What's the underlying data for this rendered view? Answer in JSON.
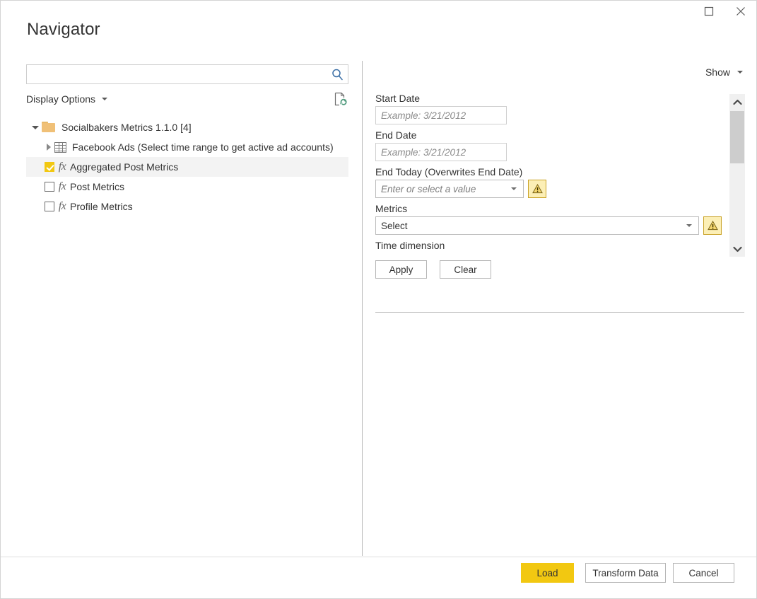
{
  "window": {
    "title": "Navigator",
    "controls": [
      {
        "name": "maximize-button",
        "icon": "maximize-icon",
        "label": ""
      },
      {
        "name": "close-button",
        "icon": "close-icon",
        "label": ""
      }
    ]
  },
  "colors": {
    "accent_yellow": "#f2c811",
    "warning_fill": "#fcefb6",
    "warning_border": "#c9a227",
    "folder_gold": "#f0c077",
    "search_icon_blue": "#3a6ea5",
    "selected_row_bg": "#f3f3f3",
    "border_gray": "#cfcfcf",
    "text_dark": "#333333"
  },
  "left_pane": {
    "search": {
      "value": "",
      "placeholder": "",
      "icon": "search-icon"
    },
    "display_options": {
      "label": "Display Options",
      "caret": "chevron-down-icon"
    },
    "refresh": {
      "icon": "document-refresh-icon",
      "tooltip": "Refresh"
    },
    "tree": [
      {
        "level": 0,
        "label": "Socialbakers Metrics 1.1.0 [4]",
        "icon": "folder-icon",
        "expander": "triangle-down",
        "expanded": true,
        "checkbox": null,
        "selected": false
      },
      {
        "level": 1,
        "label": "Facebook Ads (Select time range to get active ad accounts)",
        "icon": "table-icon",
        "expander": "triangle-right",
        "expanded": false,
        "checkbox": null,
        "selected": false
      },
      {
        "level": 1,
        "label": "Aggregated Post Metrics",
        "icon": "fx-icon",
        "expander": null,
        "expanded": false,
        "checkbox": "checked",
        "selected": true
      },
      {
        "level": 1,
        "label": "Post Metrics",
        "icon": "fx-icon",
        "expander": null,
        "expanded": false,
        "checkbox": "unchecked",
        "selected": false
      },
      {
        "level": 1,
        "label": "Profile Metrics",
        "icon": "fx-icon",
        "expander": null,
        "expanded": false,
        "checkbox": "unchecked",
        "selected": false
      }
    ]
  },
  "right_pane": {
    "show_dropdown": {
      "label": "Show",
      "caret": "chevron-down-icon"
    },
    "form": {
      "start_date": {
        "label": "Start Date",
        "value": "",
        "placeholder": "Example: 3/21/2012"
      },
      "end_date": {
        "label": "End Date",
        "value": "",
        "placeholder": "Example: 3/21/2012"
      },
      "end_today": {
        "label": "End Today (Overwrites End Date)",
        "value": "",
        "placeholder": "Enter or select a value",
        "warning_icon": "warning-triangle-icon"
      },
      "metrics": {
        "label": "Metrics",
        "value": "Select",
        "warning_icon": "warning-triangle-icon"
      },
      "time_dimension": {
        "label": "Time dimension"
      },
      "apply_label": "Apply",
      "clear_label": "Clear"
    },
    "scrollbar": {
      "up_arrow": "chevron-up-icon",
      "down_arrow": "chevron-down-icon"
    }
  },
  "footer": {
    "load_label": "Load",
    "transform_label": "Transform Data",
    "cancel_label": "Cancel"
  }
}
